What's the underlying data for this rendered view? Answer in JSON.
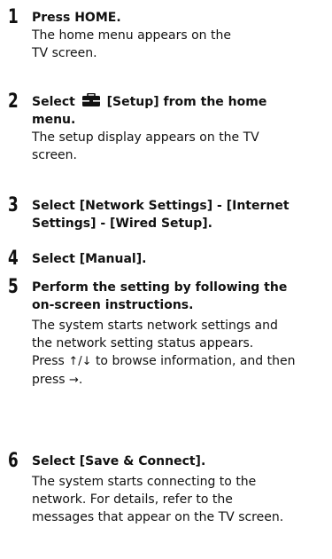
{
  "steps": [
    {
      "number": "1",
      "title": "Press HOME.",
      "description": "The home menu appears on the TV screen."
    },
    {
      "number": "2",
      "title_prefix": "Select",
      "icon": "toolbox-icon",
      "title_suffix": "[Setup] from the home menu.",
      "description": "The setup display appears on the TV screen."
    },
    {
      "number": "3",
      "title": "Select [Network Settings] - [Internet Settings] - [Wired Setup]."
    },
    {
      "number": "4",
      "title": "Select [Manual]."
    },
    {
      "number": "5",
      "title": "Perform the setting by following the on-screen instructions.",
      "description": "The system starts network settings and the network setting status appears.",
      "press_prefix": "Press",
      "up_down_arrows": "↑/↓",
      "press_middle": "to browse information, and then press",
      "right_arrow": "→",
      "press_end": "."
    },
    {
      "number": "6",
      "title": "Select [Save & Connect].",
      "description": "The system starts connecting to the network. For details, refer to the messages that appear on the TV screen."
    }
  ]
}
